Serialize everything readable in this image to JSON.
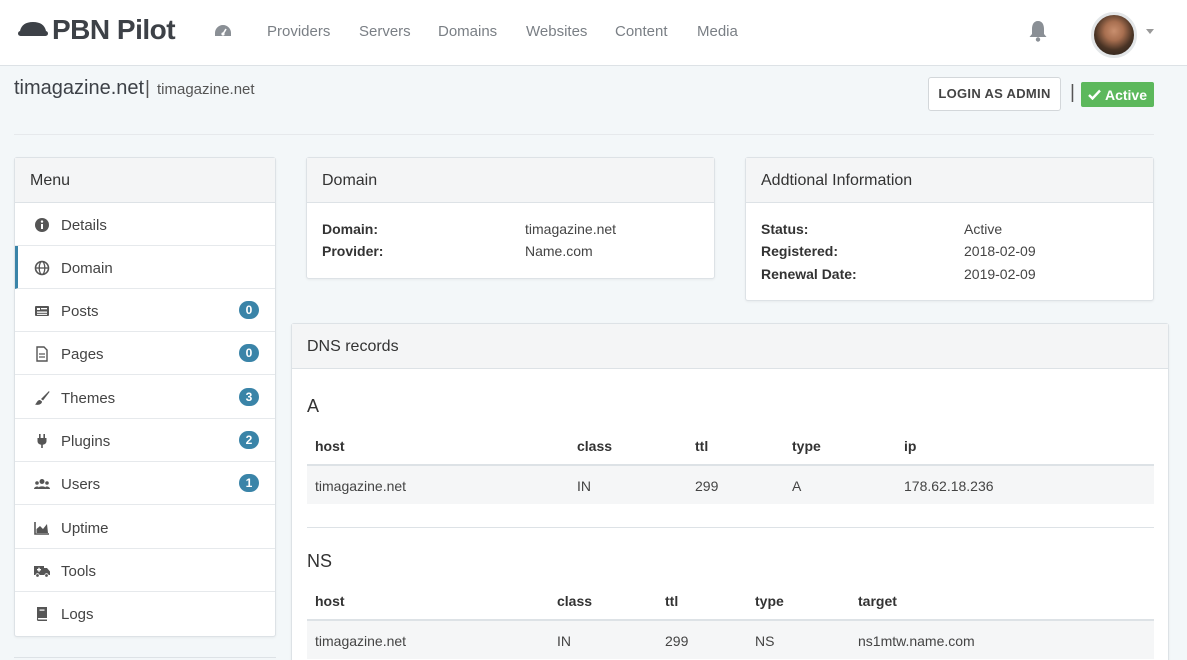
{
  "app": {
    "brand": "PBN Pilot"
  },
  "nav": {
    "items": [
      {
        "label": "Providers"
      },
      {
        "label": "Servers"
      },
      {
        "label": "Domains"
      },
      {
        "label": "Websites"
      },
      {
        "label": "Content"
      },
      {
        "label": "Media"
      }
    ]
  },
  "page": {
    "title": "timagazine.net",
    "separator": "|",
    "subtitle": "timagazine.net",
    "login_button": "LOGIN AS ADMIN",
    "status_badge": "Active"
  },
  "menu": {
    "title": "Menu",
    "items": [
      {
        "label": "Details",
        "icon": "info-icon"
      },
      {
        "label": "Domain",
        "icon": "globe-icon",
        "active": true
      },
      {
        "label": "Posts",
        "icon": "posts-icon",
        "count": "0"
      },
      {
        "label": "Pages",
        "icon": "file-icon",
        "count": "0"
      },
      {
        "label": "Themes",
        "icon": "brush-icon",
        "count": "3"
      },
      {
        "label": "Plugins",
        "icon": "plug-icon",
        "count": "2"
      },
      {
        "label": "Users",
        "icon": "users-icon",
        "count": "1"
      },
      {
        "label": "Uptime",
        "icon": "chart-icon"
      },
      {
        "label": "Tools",
        "icon": "ambulance-icon"
      },
      {
        "label": "Logs",
        "icon": "book-icon"
      }
    ]
  },
  "domain_panel": {
    "title": "Domain",
    "rows": [
      {
        "key": "Domain:",
        "value": "timagazine.net"
      },
      {
        "key": "Provider:",
        "value": "Name.com"
      }
    ]
  },
  "additional_panel": {
    "title": "Addtional Information",
    "rows": [
      {
        "key": "Status:",
        "value": "Active"
      },
      {
        "key": "Registered:",
        "value": "2018-02-09"
      },
      {
        "key": "Renewal Date:",
        "value": "2019-02-09"
      }
    ]
  },
  "dns": {
    "title": "DNS records",
    "a": {
      "heading": "A",
      "columns": [
        "host",
        "class",
        "ttl",
        "type",
        "ip"
      ],
      "rows": [
        [
          "timagazine.net",
          "IN",
          "299",
          "A",
          "178.62.18.236"
        ]
      ]
    },
    "ns": {
      "heading": "NS",
      "columns": [
        "host",
        "class",
        "ttl",
        "type",
        "target"
      ],
      "rows": [
        [
          "timagazine.net",
          "IN",
          "299",
          "NS",
          "ns1mtw.name.com"
        ]
      ]
    }
  },
  "colors": {
    "accent": "#3a84a8",
    "success": "#5cb85c",
    "background": "#f3f7f9"
  }
}
